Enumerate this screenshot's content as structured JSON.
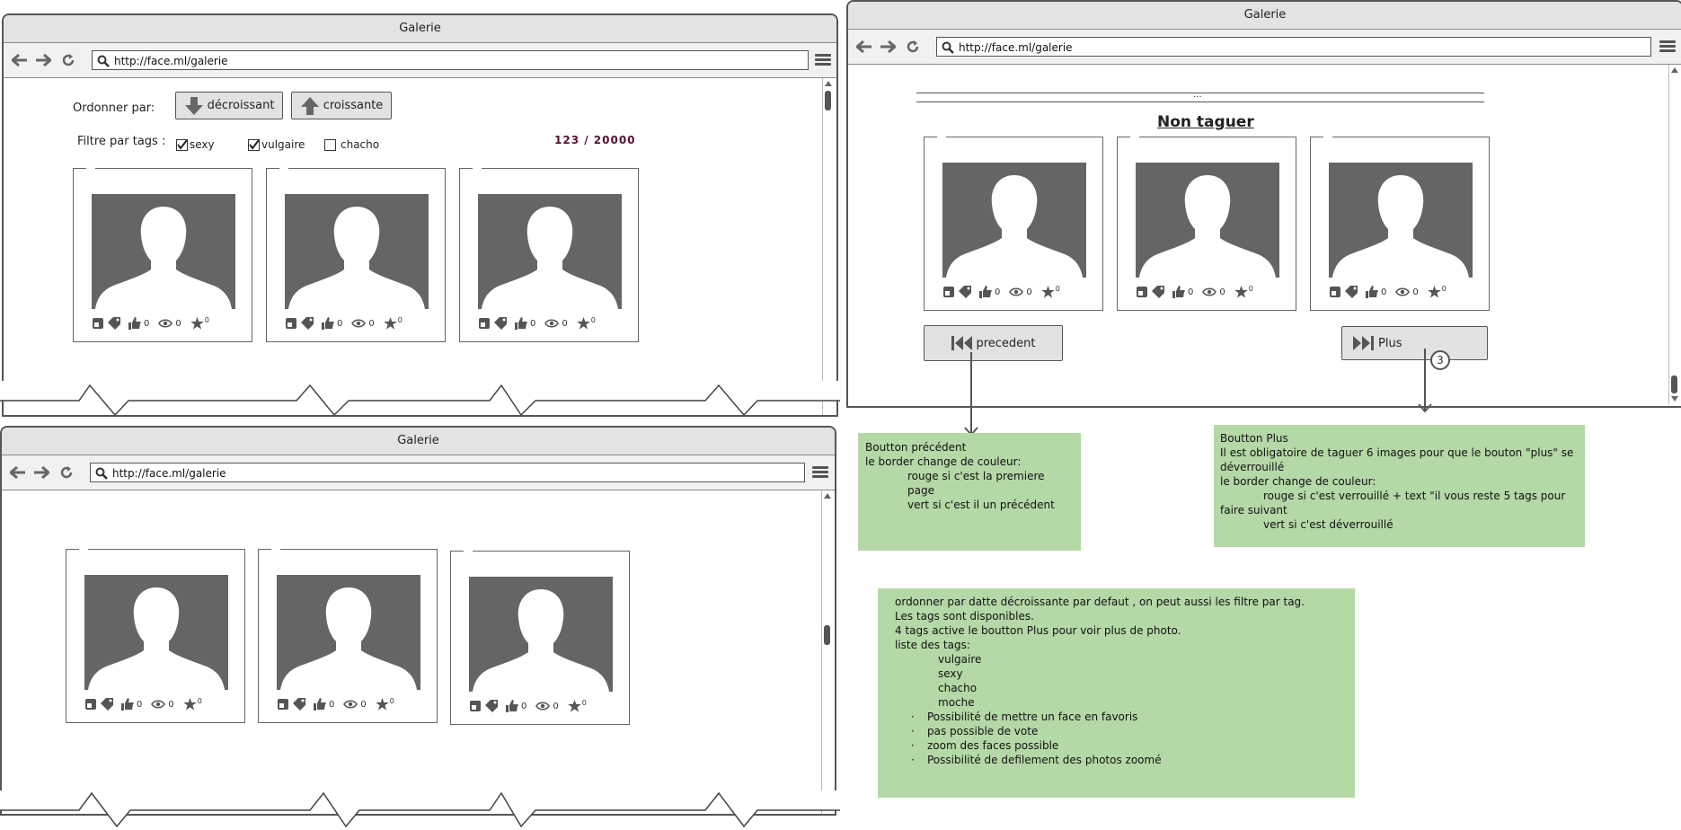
{
  "browser": {
    "title": "Galerie",
    "url": "http://face.ml/galerie"
  },
  "window1": {
    "order_label": "Ordonner  par:",
    "btn_desc": "décroissant",
    "btn_asc": "croissante",
    "filter_label": "Filtre par tags :",
    "tags": [
      {
        "label": "sexy",
        "checked": true
      },
      {
        "label": "vulgaire",
        "checked": true
      },
      {
        "label": "chacho",
        "checked": false
      }
    ],
    "counter": "123 / 20000",
    "counter_color": "#5a1030"
  },
  "card_counts": {
    "likes": "0",
    "views": "0",
    "stars": "0"
  },
  "window2": {
    "ellipsis": "...",
    "heading": "Non taguer",
    "btn_prev": "precedent",
    "btn_more": "Plus",
    "marker": "3"
  },
  "notes": {
    "prev": {
      "lines": [
        "Boutton précédent",
        "le border change de couleur:"
      ],
      "indented": [
        "rouge si c'est la premiere page",
        "vert si c'est il un précédent"
      ]
    },
    "more": {
      "lines": [
        "Boutton Plus",
        "Il est obligatoire de taguer 6 images pour que le bouton \"plus\" se déverrouillé",
        "le border change de couleur:"
      ],
      "indented_1": "rouge si c'est verrouillé + text \"il vous reste 5 tags pour",
      "cont_1": "faire suivant",
      "indented_2": "vert si c'est déverrouillé"
    },
    "main": {
      "lines": [
        "ordonner par datte décroissante par defaut , on peut aussi les filtre par tag.",
        "Les tags sont disponibles.",
        "4 tags active le boutton Plus pour voir plus de photo.",
        "liste des tags:"
      ],
      "tags": [
        "vulgaire",
        "sexy",
        "chacho",
        "moche"
      ],
      "bullets": [
        "Possibilité de mettre un face en favoris",
        "pas possible de vote",
        "zoom des faces possible",
        "Possibilité de defilement des photos zoomé"
      ]
    }
  },
  "colors": {
    "note_bg": "#b5d8a7",
    "photo_bg": "#656565"
  }
}
